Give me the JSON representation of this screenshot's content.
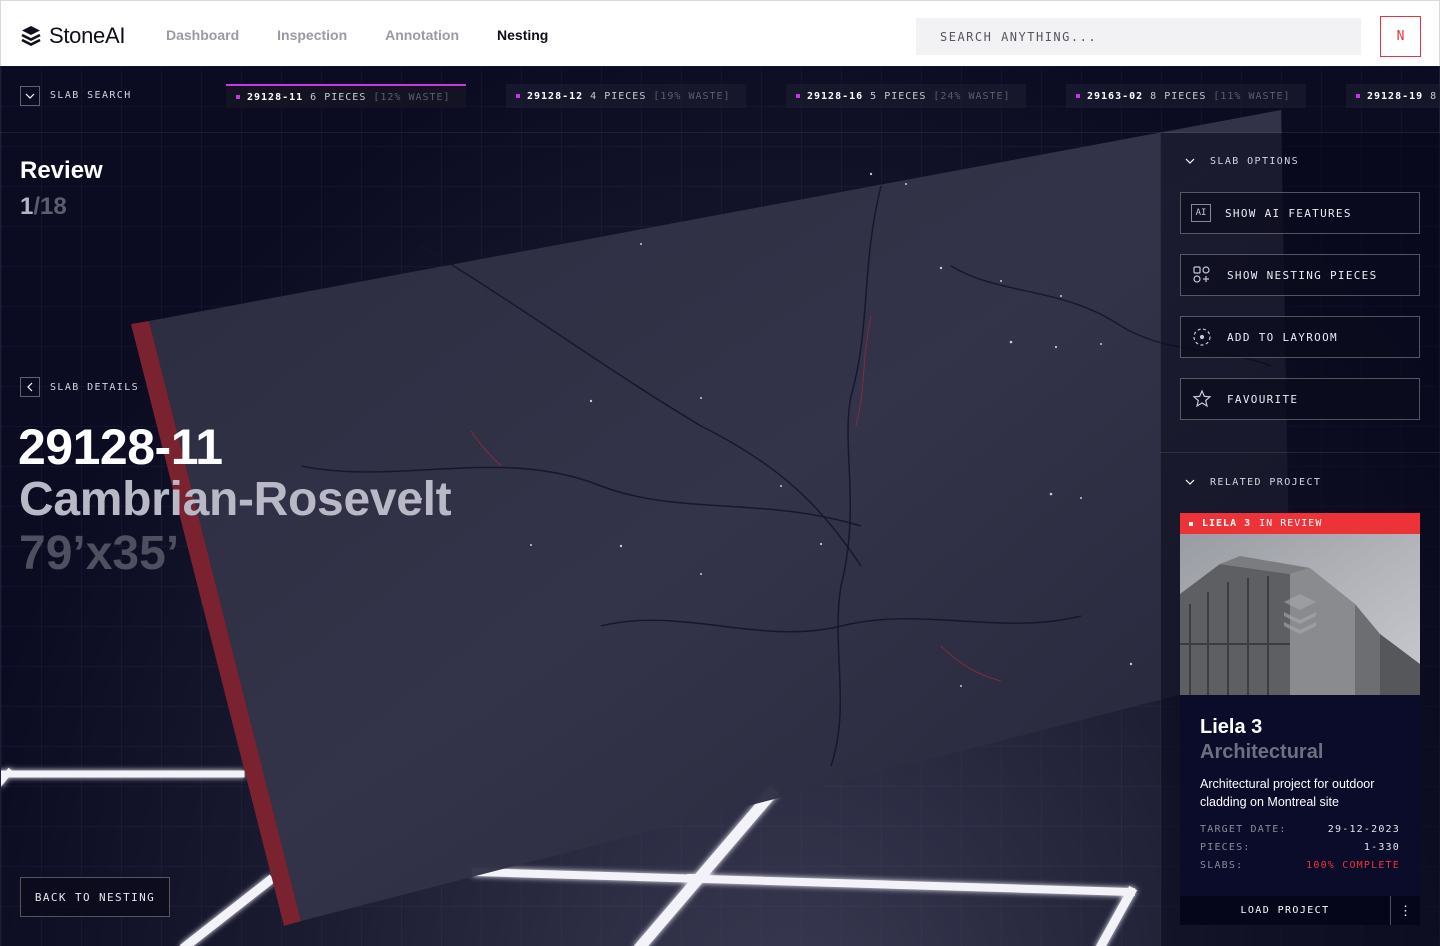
{
  "app": {
    "name": "StoneAI"
  },
  "nav": {
    "items": [
      "Dashboard",
      "Inspection",
      "Annotation",
      "Nesting"
    ],
    "active": "Nesting"
  },
  "search": {
    "placeholder": "SEARCH ANYTHING..."
  },
  "user": {
    "initial": "N"
  },
  "slab_search": {
    "label": "SLAB SEARCH"
  },
  "slab_tabs": [
    {
      "id": "29128-11",
      "pieces": "6 PIECES",
      "waste": "[12% WASTE]",
      "active": true
    },
    {
      "id": "29128-12",
      "pieces": "4 PIECES",
      "waste": "[19% WASTE]",
      "active": false
    },
    {
      "id": "29128-16",
      "pieces": "5 PIECES",
      "waste": "[24% WASTE]",
      "active": false
    },
    {
      "id": "29163-02",
      "pieces": "8 PIECES",
      "waste": "[11% WASTE]",
      "active": false
    },
    {
      "id": "29128-19",
      "pieces": "8",
      "waste": "",
      "active": false
    }
  ],
  "review": {
    "title": "Review",
    "current": "1",
    "total": "/18"
  },
  "slab_details": {
    "label": "SLAB DETAILS",
    "id": "29128-11",
    "name": "Cambrian-Rosevelt",
    "size": "79’x35’"
  },
  "back_button": "BACK TO NESTING",
  "slab_options": {
    "label": "SLAB OPTIONS",
    "buttons": [
      {
        "label": "SHOW AI FEATURES",
        "icon": "ai-icon",
        "icon_text": "AI"
      },
      {
        "label": "SHOW NESTING PIECES",
        "icon": "nesting-pieces-icon"
      },
      {
        "label": "ADD TO LAYROOM",
        "icon": "layroom-icon"
      },
      {
        "label": "FAVOURITE",
        "icon": "star-icon"
      }
    ]
  },
  "related_project": {
    "label": "RELATED PROJECT",
    "badge_name": "LIELA 3",
    "badge_status": "IN REVIEW",
    "title": "Liela 3",
    "subtitle": "Architectural",
    "description": "Architectural project for outdoor cladding on Montreal site",
    "meta": [
      {
        "key": "TARGET DATE:",
        "value": "29-12-2023"
      },
      {
        "key": "PIECES:",
        "value": "1-330"
      },
      {
        "key": "SLABS:",
        "value": "100% COMPLETE"
      }
    ],
    "load_label": "LOAD PROJECT",
    "more_icon": "⋮"
  },
  "colors": {
    "accent_purple": "#c23be0",
    "accent_red": "#ee3338",
    "background": "#0a0a1f"
  }
}
